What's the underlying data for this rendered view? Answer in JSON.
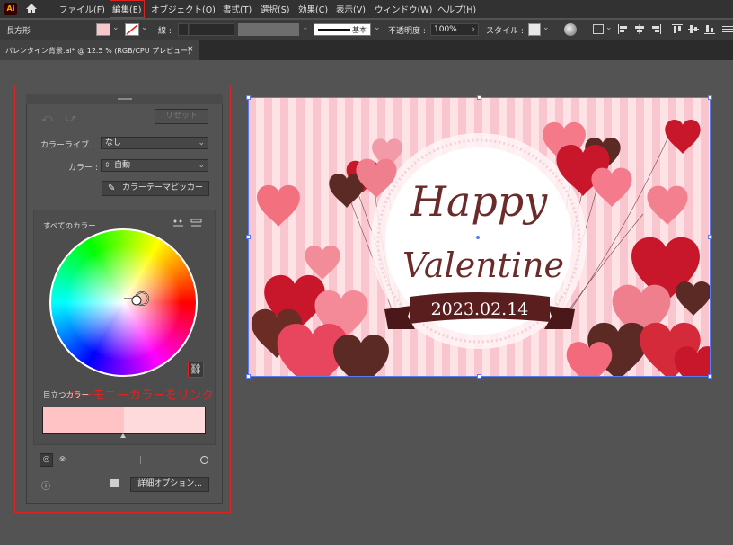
{
  "app": {
    "logo_text": "Ai"
  },
  "menu": {
    "items": [
      "ファイル(F)",
      "編集(E)",
      "オブジェクト(O)",
      "書式(T)",
      "選択(S)",
      "効果(C)",
      "表示(V)",
      "ウィンドウ(W)",
      "ヘルプ(H)"
    ],
    "highlighted": "編集(E)"
  },
  "control_bar": {
    "tool_name": "長方形",
    "stroke_label": "線 :",
    "stroke_style": "基本",
    "opacity_label": "不透明度 :",
    "opacity_value": "100%",
    "style_label": "スタイル :"
  },
  "document_tab": {
    "title": "バレンタイン背景.ai* @ 12.5 % (RGB/CPU プレビュー)",
    "close": "×"
  },
  "panel": {
    "reset_label": "リセット",
    "color_library_label": "カラーライブ...",
    "color_library_value": "なし",
    "color_label": "カラー :",
    "color_value": "自動",
    "picker_button": "カラーテーマピッカー",
    "all_colors_label": "すべてのカラー",
    "prominent_label": "目立つカラー",
    "advanced_button": "詳細オプション...",
    "swatches": [
      "#ffc3c6",
      "#ffdadd"
    ]
  },
  "annotation": {
    "text": "ハーモニーカラーをリンク",
    "color": "#e32222"
  },
  "artwork": {
    "line1": "Happy",
    "line2": "Valentine",
    "date": "2023.02.14",
    "colors": {
      "text": "#6b2b2a",
      "ribbon": "#5b1e1e",
      "stripe_a": "#f9c5cf",
      "stripe_b": "#fde2e6"
    }
  }
}
